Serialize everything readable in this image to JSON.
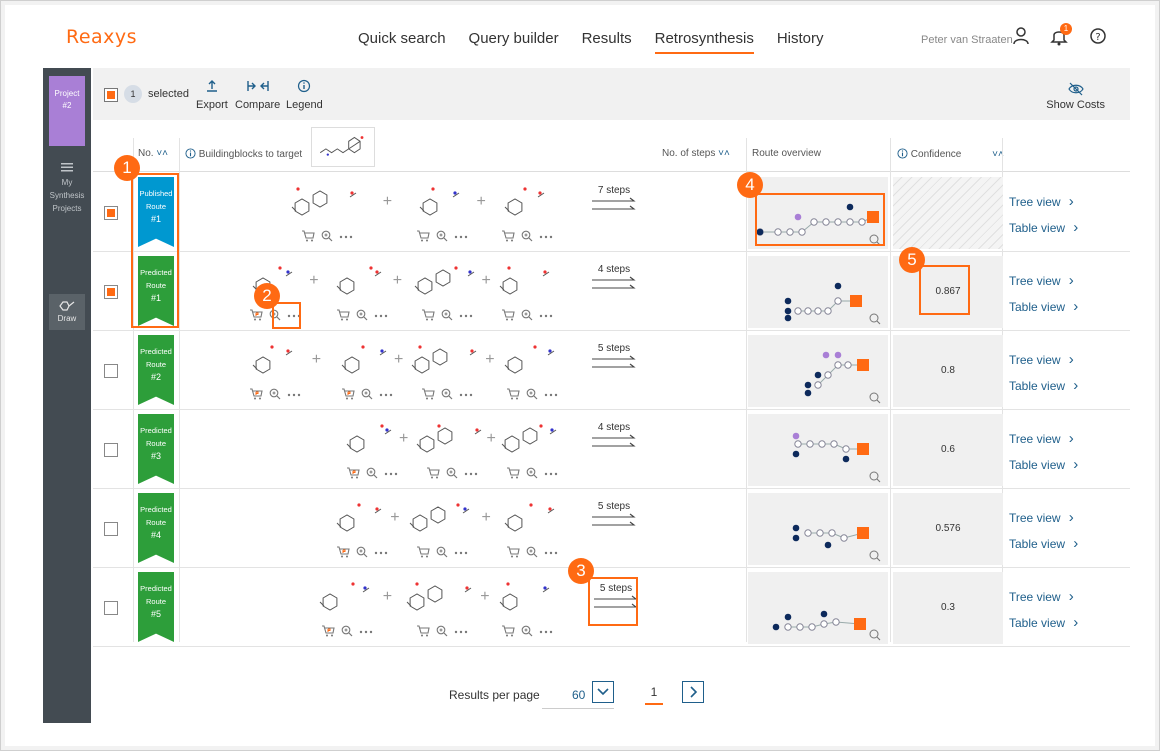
{
  "app": {
    "logo": "Reaxys"
  },
  "nav": {
    "items": [
      "Quick search",
      "Query builder",
      "Results",
      "Retrosynthesis",
      "History"
    ],
    "active_index": 3
  },
  "user": {
    "name": "Peter van Straaten",
    "notifications": "1"
  },
  "sidebar": {
    "project_label": "Project",
    "project_num": "#2",
    "my_projects": [
      "My",
      "Synthesis",
      "Projects"
    ],
    "draw": "Draw"
  },
  "toolbar": {
    "selected_count": "1",
    "selected_label": "selected",
    "export": "Export",
    "compare": "Compare",
    "legend": "Legend",
    "show_costs": "Show Costs"
  },
  "table": {
    "col_no": "No.",
    "col_bb": "Buildingblocks to target",
    "col_steps": "No. of steps",
    "col_route": "Route overview",
    "col_conf": "Confidence",
    "tree_view": "Tree view",
    "table_view": "Table view",
    "rows": [
      {
        "kind": [
          "Published",
          "Route"
        ],
        "num": "#1",
        "color": "#0098d0",
        "checked": true,
        "steps": "7 steps",
        "confidence": ""
      },
      {
        "kind": [
          "Predicted",
          "Route"
        ],
        "num": "#1",
        "color": "#2d9e3a",
        "checked": true,
        "steps": "4 steps",
        "confidence": "0.867"
      },
      {
        "kind": [
          "Predicted",
          "Route"
        ],
        "num": "#2",
        "color": "#2d9e3a",
        "checked": false,
        "steps": "5 steps",
        "confidence": "0.8"
      },
      {
        "kind": [
          "Predicted",
          "Route"
        ],
        "num": "#3",
        "color": "#2d9e3a",
        "checked": false,
        "steps": "4 steps",
        "confidence": "0.6"
      },
      {
        "kind": [
          "Predicted",
          "Route"
        ],
        "num": "#4",
        "color": "#2d9e3a",
        "checked": false,
        "steps": "5 steps",
        "confidence": "0.576"
      },
      {
        "kind": [
          "Predicted",
          "Route"
        ],
        "num": "#5",
        "color": "#2d9e3a",
        "checked": false,
        "steps": "5 steps",
        "confidence": "0.3"
      }
    ]
  },
  "callouts": [
    "1",
    "2",
    "3",
    "4",
    "5"
  ],
  "pager": {
    "label": "Results per page",
    "per_page": "60",
    "page": "1"
  },
  "colors": {
    "accent": "#ff6a13",
    "published": "#0098d0",
    "predicted": "#2d9e3a",
    "link": "#1f5f8b"
  }
}
